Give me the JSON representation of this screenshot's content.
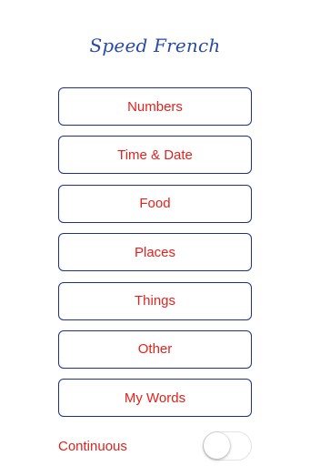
{
  "app": {
    "title": "Speed French"
  },
  "menu": {
    "items": [
      {
        "label": "Numbers"
      },
      {
        "label": "Time & Date"
      },
      {
        "label": "Food"
      },
      {
        "label": "Places"
      },
      {
        "label": "Things"
      },
      {
        "label": "Other"
      },
      {
        "label": "My Words"
      }
    ]
  },
  "settings": {
    "continuous": {
      "label": "Continuous",
      "enabled": false
    }
  },
  "colors": {
    "title": "#2a4aa8",
    "button_border": "#1f2f8f",
    "button_text": "#e0231f",
    "background": "#ffffff"
  }
}
